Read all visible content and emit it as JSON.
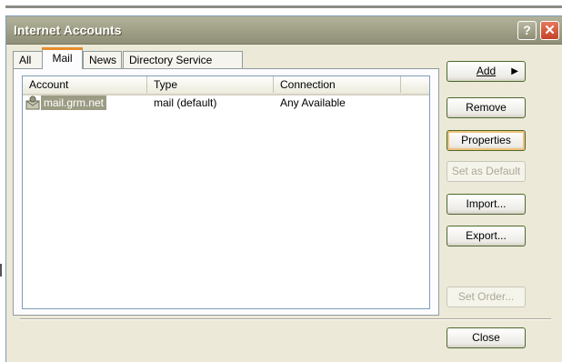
{
  "window": {
    "title": "Internet Accounts"
  },
  "titlebar": {
    "help_glyph": "?",
    "close_glyph": "✕"
  },
  "tabs": [
    {
      "label": "All",
      "active": false
    },
    {
      "label": "Mail",
      "active": true
    },
    {
      "label": "News",
      "active": false
    },
    {
      "label": "Directory Service",
      "active": false
    }
  ],
  "list": {
    "columns": [
      "Account",
      "Type",
      "Connection"
    ],
    "rows": [
      {
        "account": "mail.grm.net",
        "type": "mail (default)",
        "connection": "Any Available",
        "icon": "mail-account-icon",
        "selected": true
      }
    ]
  },
  "buttons": {
    "add": {
      "label": "Add",
      "arrow": "▶",
      "enabled": true
    },
    "remove": {
      "label": "Remove",
      "enabled": true
    },
    "properties": {
      "label": "Properties",
      "enabled": true
    },
    "set_default": {
      "label": "Set as Default",
      "enabled": false
    },
    "import": {
      "label": "Import...",
      "enabled": true
    },
    "export": {
      "label": "Export...",
      "enabled": true
    },
    "set_order": {
      "label": "Set Order...",
      "enabled": false
    },
    "close": {
      "label": "Close",
      "enabled": true
    }
  },
  "colors": {
    "title_bar": "#a3a38a",
    "selection": "#9c9c84",
    "active_tab_accent": "#e68b2c",
    "button_border": "#4c6a2c"
  }
}
